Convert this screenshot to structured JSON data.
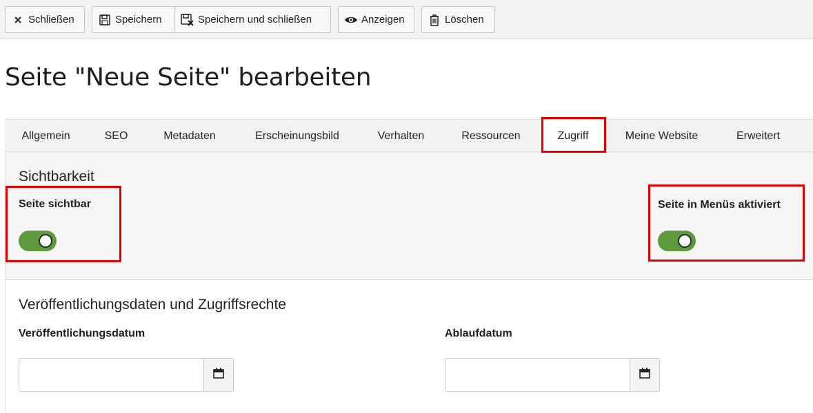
{
  "toolbar": {
    "close_label": "Schließen",
    "save_label": "Speichern",
    "save_close_label": "Speichern und schließen",
    "view_label": "Anzeigen",
    "delete_label": "Löschen"
  },
  "page": {
    "title": "Seite \"Neue Seite\" bearbeiten"
  },
  "tabs": [
    {
      "label": "Allgemein"
    },
    {
      "label": "SEO"
    },
    {
      "label": "Metadaten"
    },
    {
      "label": "Erscheinungsbild"
    },
    {
      "label": "Verhalten"
    },
    {
      "label": "Ressourcen"
    },
    {
      "label": "Zugriff",
      "active": true
    },
    {
      "label": "Meine Website"
    },
    {
      "label": "Erweitert"
    }
  ],
  "visibility": {
    "title": "Sichtbarkeit",
    "page_visible_label": "Seite sichtbar",
    "page_visible_on": true,
    "menu_enabled_label": "Seite in Menüs aktiviert",
    "menu_enabled_on": true
  },
  "publishing": {
    "title": "Veröffentlichungsdaten und Zugriffsrechte",
    "publish_date_label": "Veröffentlichungsdatum",
    "publish_date_value": "",
    "expiry_date_label": "Ablaufdatum",
    "expiry_date_value": ""
  },
  "colors": {
    "toggle_on": "#5c9a3b",
    "highlight": "#e30000"
  }
}
